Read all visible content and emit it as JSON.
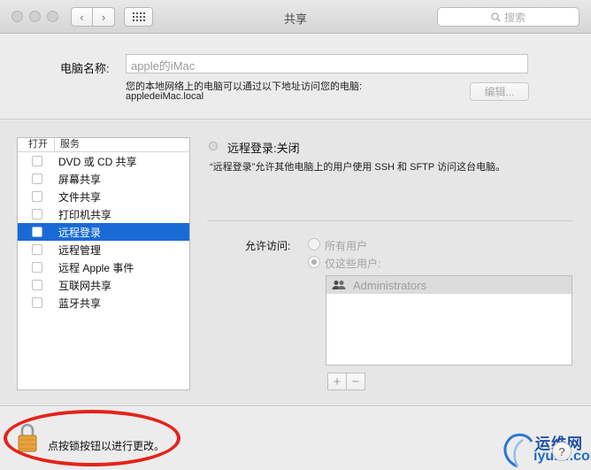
{
  "window": {
    "title": "共享"
  },
  "search": {
    "placeholder": "搜索"
  },
  "computer_name": {
    "label": "电脑名称:",
    "value": "apple的iMac",
    "address_description": "您的本地网络上的电脑可以通过以下地址访问您的电脑:",
    "address": "appledeiMac.local",
    "edit_label": "编辑..."
  },
  "services": {
    "header_on": "打开",
    "header_service": "服务",
    "selected_index": 4,
    "items": [
      {
        "label": "DVD 或 CD 共享",
        "checked": false
      },
      {
        "label": "屏幕共享",
        "checked": false
      },
      {
        "label": "文件共享",
        "checked": false
      },
      {
        "label": "打印机共享",
        "checked": false
      },
      {
        "label": "远程登录",
        "checked": false
      },
      {
        "label": "远程管理",
        "checked": false
      },
      {
        "label": "远程 Apple 事件",
        "checked": false
      },
      {
        "label": "互联网共享",
        "checked": false
      },
      {
        "label": "蓝牙共享",
        "checked": false
      }
    ]
  },
  "detail": {
    "status": "远程登录:关闭",
    "description": "“远程登录”允许其他电脑上的用户使用 SSH 和 SFTP 访问这台电脑。",
    "allow_label": "允许访问:",
    "option_all": "所有用户",
    "option_only": "仅这些用户:",
    "selected_option": "only",
    "users": [
      "Administrators"
    ],
    "add_label": "+",
    "remove_label": "−"
  },
  "bottom": {
    "lock_text": "点按锁按钮以进行更改。",
    "help_label": "?"
  },
  "watermark": {
    "text_cn": "运维网",
    "text_en": "iyunv.com"
  },
  "colors": {
    "selection": "#1a6ad6",
    "annotation": "#e4231a"
  }
}
